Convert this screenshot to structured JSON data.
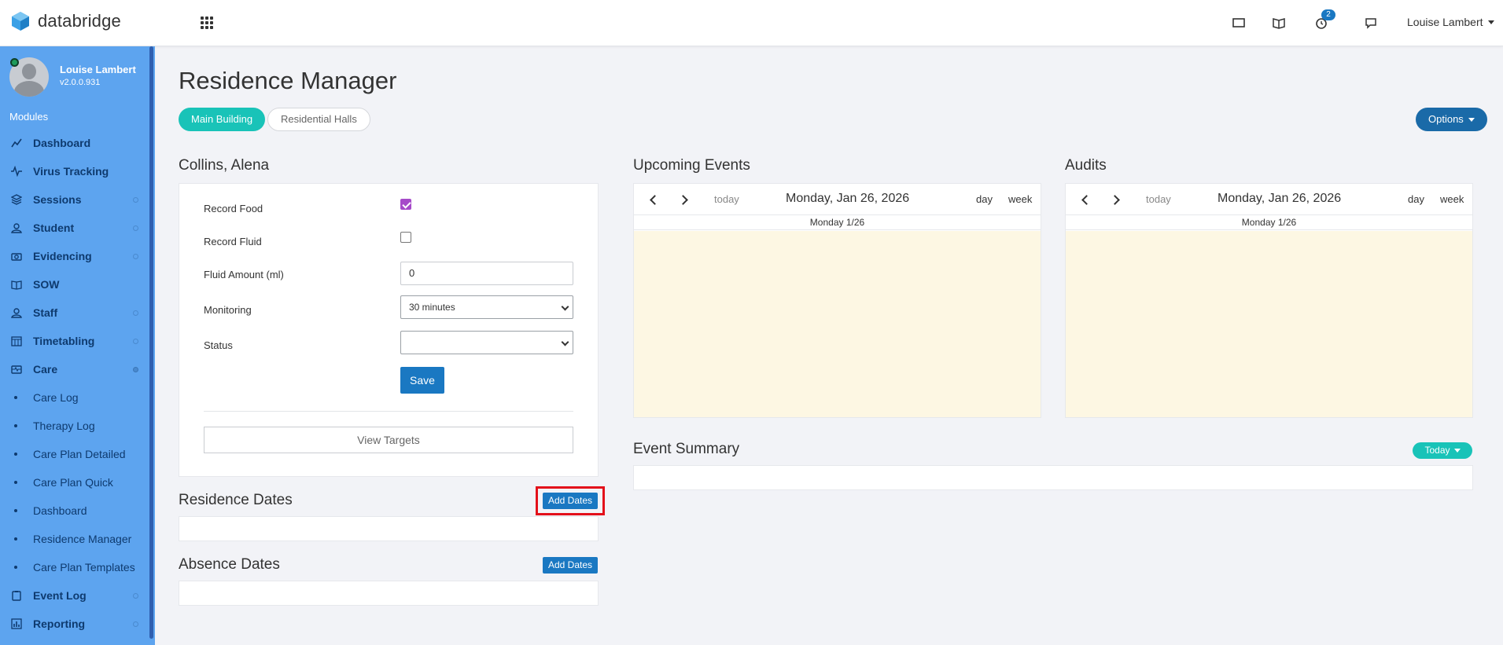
{
  "app": {
    "name": "databridge"
  },
  "topbar": {
    "notification_count": "2",
    "user_name": "Louise Lambert"
  },
  "sidebar": {
    "profile_name": "Louise Lambert",
    "version": "v2.0.0.931",
    "modules_label": "Modules",
    "items": [
      {
        "label": "Dashboard",
        "icon": "chart-line-icon"
      },
      {
        "label": "Virus Tracking",
        "icon": "pulse-icon"
      },
      {
        "label": "Sessions",
        "icon": "layers-icon"
      },
      {
        "label": "Student",
        "icon": "user-icon"
      },
      {
        "label": "Evidencing",
        "icon": "camera-icon"
      },
      {
        "label": "SOW",
        "icon": "book-open-icon"
      },
      {
        "label": "Staff",
        "icon": "user-icon"
      },
      {
        "label": "Timetabling",
        "icon": "calendar-grid-icon"
      },
      {
        "label": "Care",
        "icon": "card-icon"
      }
    ],
    "care_subitems": [
      "Care Log",
      "Therapy Log",
      "Care Plan Detailed",
      "Care Plan Quick",
      "Dashboard",
      "Residence Manager",
      "Care Plan Templates"
    ],
    "bottom_items": [
      {
        "label": "Event Log",
        "icon": "clipboard-icon"
      },
      {
        "label": "Reporting",
        "icon": "bar-chart-icon"
      }
    ]
  },
  "page": {
    "title": "Residence Manager",
    "tabs": [
      "Main Building",
      "Residential Halls"
    ],
    "options_label": "Options"
  },
  "student_form": {
    "title": "Collins, Alena",
    "record_food_label": "Record Food",
    "record_food_checked": true,
    "record_fluid_label": "Record Fluid",
    "record_fluid_checked": false,
    "fluid_amount_label": "Fluid Amount (ml)",
    "fluid_amount_value": "0",
    "monitoring_label": "Monitoring",
    "monitoring_value": "30 minutes",
    "status_label": "Status",
    "status_value": "",
    "save_label": "Save",
    "view_targets_label": "View Targets"
  },
  "residence_dates": {
    "title": "Residence Dates",
    "add_label": "Add Dates"
  },
  "absence_dates": {
    "title": "Absence Dates",
    "add_label": "Add Dates"
  },
  "upcoming_events": {
    "title": "Upcoming Events",
    "today_label": "today",
    "date": "Monday, Jan 26, 2026",
    "day_label": "day",
    "week_label": "week",
    "column": "Monday 1/26"
  },
  "audits": {
    "title": "Audits",
    "today_label": "today",
    "date": "Monday, Jan 26, 2026",
    "day_label": "day",
    "week_label": "week",
    "column": "Monday 1/26"
  },
  "event_summary": {
    "title": "Event Summary",
    "filter_label": "Today"
  },
  "colors": {
    "accent_teal": "#19c3b8",
    "primary_blue": "#1a78c2",
    "sidebar": "#5da4ef"
  }
}
